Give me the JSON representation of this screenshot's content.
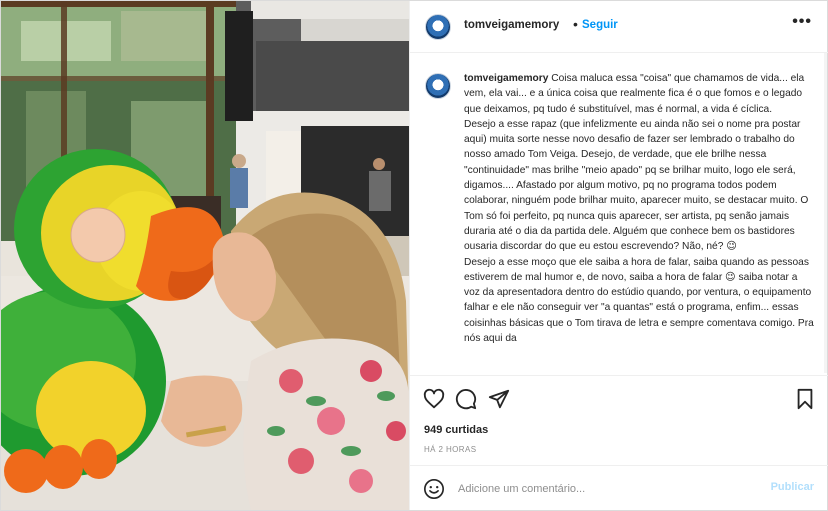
{
  "post": {
    "username": "tomveigamemory",
    "follow_label": "Seguir",
    "separator": "•",
    "more_label": "•••",
    "caption_username": "tomveigamemory",
    "caption_text": " Coisa maluca essa \"coisa\" que chamamos de vida... ela vem, ela vai... e a única coisa que realmente fica é o que fomos e o legado que deixamos, pq tudo é substituível, mas é normal, a vida é cíclica.\nDesejo a esse rapaz (que infelizmente eu ainda não sei o nome pra postar aqui) muita sorte nesse novo desafio de fazer ser lembrado o trabalho do nosso amado Tom Veiga. Desejo, de verdade, que ele brilhe nessa \"continuidade\" mas brilhe \"meio apado\" pq se brilhar muito, logo ele será, digamos.... Afastado por algum motivo, pq no programa todos podem colaborar, ninguém pode brilhar muito, aparecer muito, se destacar muito. O Tom só foi perfeito, pq nunca quis aparecer, ser artista, pq senão jamais duraria até o dia da partida dele. Alguém que conhece bem os bastidores ousaria discordar do que eu estou escrevendo? Não, né? 😉\nDesejo a esse moço que ele saiba a hora de falar, saiba quando as pessoas estiverem de mal humor e, de novo, saiba a hora de falar 😉 saiba notar a voz da apresentadora dentro do estúdio quando, por ventura, o equipamento falhar e ele não conseguir ver \"a quantas\" está o programa, enfim... essas coisinhas básicas que o Tom tirava de letra e sempre comentava comigo. Pra nós aqui da",
    "likes": "949 curtidas",
    "time": "HÁ 2 HORAS",
    "comment_placeholder": "Adicione um comentário...",
    "publish_label": "Publicar"
  },
  "icons": {
    "like": "heart-icon",
    "comment": "speech-bubble-icon",
    "share": "paper-plane-icon",
    "save": "bookmark-icon",
    "emoji": "smiley-icon",
    "more": "ellipsis-icon"
  },
  "colors": {
    "accent": "#0095f6",
    "publish_disabled": "#b2dffc",
    "muted": "#8e8e8e",
    "text": "#262626"
  }
}
